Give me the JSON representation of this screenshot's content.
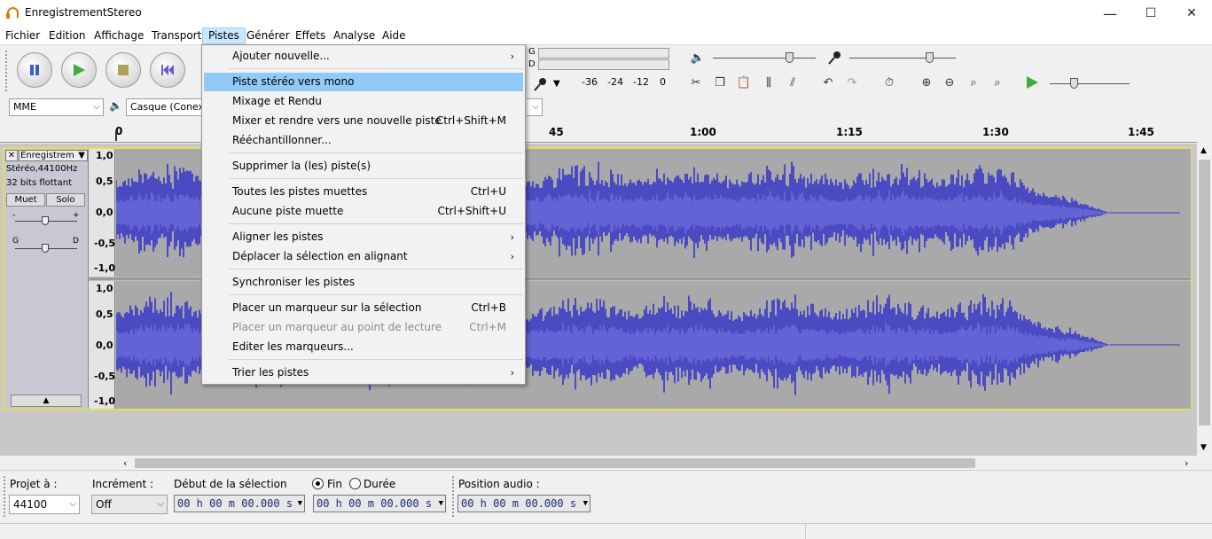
{
  "window": {
    "title": "EnregistrementStereo",
    "minimize": "—",
    "maximize": "☐",
    "close": "✕"
  },
  "menubar": [
    "Fichier",
    "Edition",
    "Affichage",
    "Transport",
    "Pistes",
    "Générer",
    "Effets",
    "Analyse",
    "Aide"
  ],
  "meter": {
    "left_ch": "G",
    "right_ch": "D",
    "ticks": [
      "-36",
      "-24",
      "-12",
      "0"
    ]
  },
  "device": {
    "host": "MME",
    "output": "Casque (Conexan"
  },
  "ruler": [
    "45",
    "1:00",
    "1:15",
    "1:30",
    "1:45"
  ],
  "ruler_zero": "0",
  "track": {
    "name": "Enregistrem",
    "info1": "Stéréo,44100Hz",
    "info2": "32 bits flottant",
    "mute": "Muet",
    "solo": "Solo",
    "gain_minus": "-",
    "gain_plus": "+",
    "pan_left": "G",
    "pan_right": "D",
    "scale": [
      "1,0",
      "0,5",
      "0,0",
      "-0,5",
      "-1,0"
    ]
  },
  "pistes_menu": {
    "add_new": "Ajouter nouvelle...",
    "stereo_to_mono": "Piste stéréo vers mono",
    "mix_render": "Mixage et Rendu",
    "mix_render_new": "Mixer et rendre vers une nouvelle piste",
    "mix_render_new_sc": "Ctrl+Shift+M",
    "resample": "Rééchantillonner...",
    "remove": "Supprimer la (les) piste(s)",
    "mute_all": "Toutes les pistes muettes",
    "mute_all_sc": "Ctrl+U",
    "unmute_all": "Aucune piste muette",
    "unmute_all_sc": "Ctrl+Shift+U",
    "align": "Aligner les pistes",
    "move_align": "Déplacer la sélection en alignant",
    "sync": "Synchroniser les pistes",
    "label_sel": "Placer un marqueur sur la sélection",
    "label_sel_sc": "Ctrl+B",
    "label_play": "Placer un marqueur au point de lecture",
    "label_play_sc": "Ctrl+M",
    "edit_labels": "Editer les marqueurs...",
    "sort": "Trier les pistes"
  },
  "selection": {
    "project_rate_label": "Projet à :",
    "project_rate": "44100",
    "snap_label": "Incrément :",
    "snap": "Off",
    "sel_start_label": "Début de la sélection",
    "end_label": "Fin",
    "duration_label": "Durée",
    "sel_start": "00 h 00 m 00.000 s",
    "sel_end": "00 h 00 m 00.000 s",
    "audio_pos_label": "Position audio :",
    "audio_pos": "00 h 00 m 00.000 s"
  },
  "colors": {
    "waveform": "#3232c8",
    "waveform_rms": "#6464dc",
    "menu_highlight": "#91c9f7",
    "track_border": "#e3dd57"
  }
}
